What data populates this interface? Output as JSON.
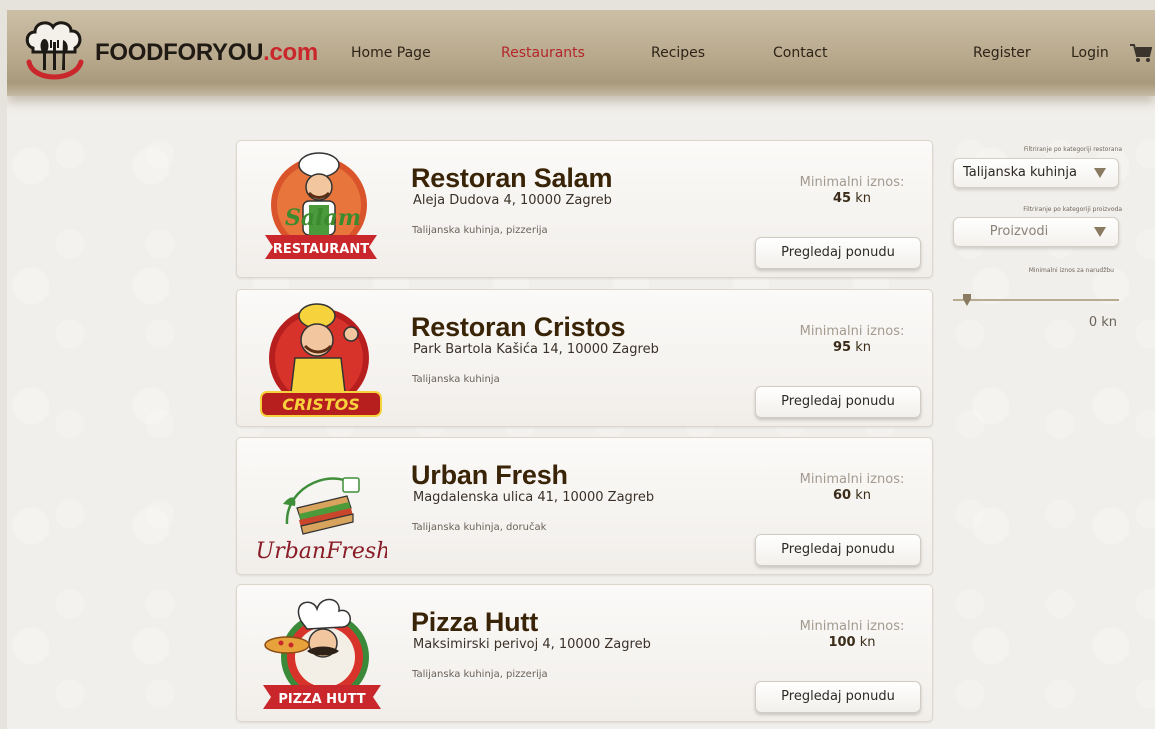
{
  "brand": {
    "name": "FOODFORYOU",
    "suffix": ".com"
  },
  "nav": {
    "items": [
      {
        "label": "Home Page",
        "active": false
      },
      {
        "label": "Restaurants",
        "active": true
      },
      {
        "label": "Recipes",
        "active": false
      },
      {
        "label": "Contact",
        "active": false
      }
    ],
    "register": "Register",
    "login": "Login",
    "cart_icon": "shopping-cart-icon"
  },
  "restaurants": [
    {
      "name": "Restoran Salam",
      "address": "Aleja Dudova 4, 10000 Zagreb",
      "categories": "Talijanska kuhinja, pizzerija",
      "min_label": "Minimalni iznos:",
      "min_amount": "45",
      "currency": "kn",
      "button": "Pregledaj ponudu",
      "logo_text": "RESTAURANT",
      "logo_script": "Salam"
    },
    {
      "name": "Restoran Cristos",
      "address": "Park Bartola Kašića 14, 10000 Zagreb",
      "categories": "Talijanska kuhinja",
      "min_label": "Minimalni iznos:",
      "min_amount": "95",
      "currency": "kn",
      "button": "Pregledaj ponudu",
      "logo_text": "CRISTOS"
    },
    {
      "name": "Urban Fresh",
      "address": "Magdalenska ulica 41, 10000 Zagreb",
      "categories": "Talijanska kuhinja, doručak",
      "min_label": "Minimalni iznos:",
      "min_amount": "60",
      "currency": "kn",
      "button": "Pregledaj ponudu",
      "logo_text": "UrbanFresh"
    },
    {
      "name": "Pizza Hutt",
      "address": "Maksimirski perivoj 4, 10000 Zagreb",
      "categories": "Talijanska kuhinja, pizzerija",
      "min_label": "Minimalni iznos:",
      "min_amount": "100",
      "currency": "kn",
      "button": "Pregledaj ponudu",
      "logo_text": "PIZZA HUTT"
    }
  ],
  "filters": {
    "restaurant_category": {
      "caption": "Filtriranje po kategoriji restorana",
      "value": "Talijanska kuhinja"
    },
    "product_category": {
      "caption": "Filtriranje po kategoriji proizvoda",
      "placeholder": "Proizvodi"
    },
    "min_order": {
      "caption": "Minimalni iznos za narudžbu",
      "value": "0 kn",
      "fraction": 0.0
    }
  },
  "colors": {
    "accent_red": "#b3262a",
    "title_brown": "#3a2408",
    "header_tan": "#b8a98d"
  }
}
